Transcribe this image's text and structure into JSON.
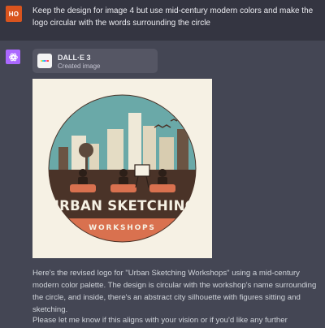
{
  "user_message": {
    "avatar_initials": "HO",
    "text": "Keep the design for image 4 but use mid-century modern colors and make the logo circular with the words surrounding the circle"
  },
  "assistant": {
    "icon": "openai-logo-icon",
    "tool": {
      "name": "DALL·E 3",
      "subtitle": "Created image"
    },
    "image": {
      "logo_line1": "URBAN SKETCHING",
      "logo_line2": "WORKSHOPS"
    },
    "reply_1": "Here's the revised logo for \"Urban Sketching Workshops\" using a mid-century modern color palette. The design is circular with the workshop's name surrounding the circle, and inside, there's an abstract city silhouette with figures sitting and sketching.",
    "reply_2": "Please let me know if this aligns with your vision or if you'd like any further adjustments!"
  },
  "colors": {
    "user_bg": "#343541",
    "assistant_bg": "#444654",
    "user_avatar": "#d9541e",
    "gpt_avatar": "#ab68ff",
    "logo_teal": "#6aa9a8",
    "logo_brown": "#4a3328",
    "logo_orange": "#d9714f",
    "logo_cream": "#f6f1e4"
  }
}
